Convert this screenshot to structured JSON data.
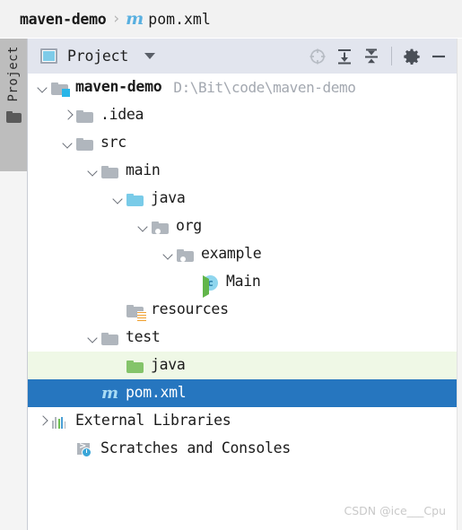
{
  "breadcrumb": {
    "project": "maven-demo",
    "separator": "›",
    "file_icon": "maven-m-icon",
    "file": "pom.xml"
  },
  "tool_strip": {
    "label": "Project",
    "icon": "project-folder-icon"
  },
  "toolbar": {
    "icon": "project-view-icon",
    "title": "Project",
    "caret": "chevron-down-icon",
    "buttons": [
      {
        "name": "select-opened-file-icon",
        "title": "Select Opened File",
        "disabled": true
      },
      {
        "name": "expand-all-icon",
        "title": "Expand All",
        "disabled": false
      },
      {
        "name": "collapse-all-icon",
        "title": "Collapse All",
        "disabled": false
      },
      {
        "name": "settings-gear-icon",
        "title": "Settings",
        "disabled": false
      },
      {
        "name": "hide-minimize-icon",
        "title": "Hide",
        "disabled": false
      }
    ]
  },
  "tree": {
    "rows": [
      {
        "label": "maven-demo",
        "path": "D:\\Bit\\code\\maven-demo",
        "indent": 0,
        "arrow": "down",
        "icon": "module-folder-icon",
        "bold": true,
        "state": "normal"
      },
      {
        "label": ".idea",
        "path": "",
        "indent": 1,
        "arrow": "right",
        "icon": "folder-icon",
        "bold": false,
        "state": "normal"
      },
      {
        "label": "src",
        "path": "",
        "indent": 1,
        "arrow": "down",
        "icon": "folder-icon",
        "bold": false,
        "state": "normal"
      },
      {
        "label": "main",
        "path": "",
        "indent": 2,
        "arrow": "down",
        "icon": "folder-icon",
        "bold": false,
        "state": "normal"
      },
      {
        "label": "java",
        "path": "",
        "indent": 3,
        "arrow": "down",
        "icon": "source-root-folder-icon",
        "bold": false,
        "state": "normal"
      },
      {
        "label": "org",
        "path": "",
        "indent": 4,
        "arrow": "down",
        "icon": "package-folder-icon",
        "bold": false,
        "state": "normal"
      },
      {
        "label": "example",
        "path": "",
        "indent": 5,
        "arrow": "down",
        "icon": "package-folder-icon",
        "bold": false,
        "state": "normal"
      },
      {
        "label": "Main",
        "path": "",
        "indent": 6,
        "arrow": "none",
        "icon": "java-class-runnable-icon",
        "bold": false,
        "state": "normal"
      },
      {
        "label": "resources",
        "path": "",
        "indent": 3,
        "arrow": "none",
        "icon": "resources-folder-icon",
        "bold": false,
        "state": "normal"
      },
      {
        "label": "test",
        "path": "",
        "indent": 2,
        "arrow": "down",
        "icon": "folder-icon",
        "bold": false,
        "state": "normal"
      },
      {
        "label": "java",
        "path": "",
        "indent": 3,
        "arrow": "none",
        "icon": "test-source-root-folder-icon",
        "bold": false,
        "state": "highlight"
      },
      {
        "label": "pom.xml",
        "path": "",
        "indent": 2,
        "arrow": "none",
        "icon": "maven-m-icon",
        "bold": false,
        "state": "selected"
      },
      {
        "label": "External Libraries",
        "path": "",
        "indent": 0,
        "arrow": "right",
        "icon": "external-libraries-icon",
        "bold": false,
        "state": "normal"
      },
      {
        "label": "Scratches and Consoles",
        "path": "",
        "indent": 1,
        "arrow": "none",
        "icon": "scratches-icon",
        "bold": false,
        "state": "normal"
      }
    ]
  },
  "watermark": "CSDN @ice___Cpu",
  "colors": {
    "selection": "#2676bf",
    "test_highlight": "#eff8e6",
    "source_root": "#79cbe8",
    "test_root": "#84c46a",
    "toolbar_bg": "#e2e5ee",
    "titlebar_bg": "#f2f2f2",
    "maven_accent": "#59b0e0",
    "path_text": "#a3a8b0"
  }
}
